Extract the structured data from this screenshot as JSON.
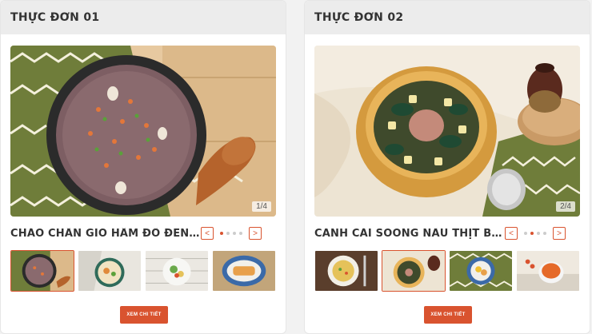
{
  "colors": {
    "accent": "#d9532f",
    "header_bg": "#ececec",
    "page_bg": "#f2f2f2"
  },
  "cards": [
    {
      "title": "THỰC ĐƠN 01",
      "dish_name": "CHÁO CHÂN GIÒ HẦM ĐỖ ĐEN (...",
      "counter": "1/4",
      "prev_label": "<",
      "next_label": ">",
      "detail_button": "XEM CHI TIẾT",
      "active_slide": 1,
      "total_slides": 4
    },
    {
      "title": "THỰC ĐƠN 02",
      "dish_name": "CANH CẢI SOONG NẤU THỊT BÒ ...",
      "counter": "2/4",
      "prev_label": "<",
      "next_label": ">",
      "detail_button": "XEM CHI TIẾT",
      "active_slide": 2,
      "total_slides": 4
    }
  ]
}
